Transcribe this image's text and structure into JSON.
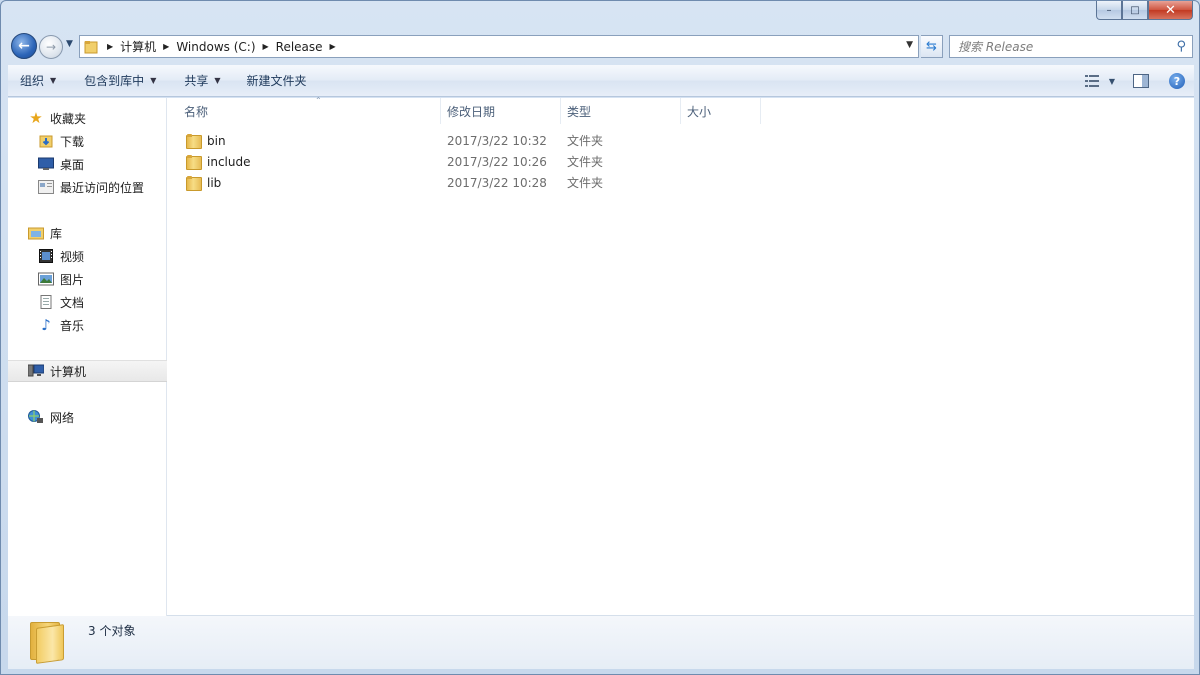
{
  "window": {
    "caption": {
      "minimize": "–",
      "maximize": "□",
      "close": "✕"
    }
  },
  "nav": {
    "breadcrumbs": [
      "计算机",
      "Windows (C:)",
      "Release"
    ],
    "search_placeholder": "搜索 Release"
  },
  "toolbar": {
    "organize": "组织",
    "include_in_library": "包含到库中",
    "share": "共享",
    "new_folder": "新建文件夹"
  },
  "sidebar": {
    "items": [
      {
        "label": "收藏夹",
        "icon": "star-icon"
      },
      {
        "label": "下载",
        "icon": "download-icon"
      },
      {
        "label": "桌面",
        "icon": "desktop-icon"
      },
      {
        "label": "最近访问的位置",
        "icon": "recent-places-icon"
      },
      {
        "label": "库",
        "icon": "library-icon"
      },
      {
        "label": "视频",
        "icon": "video-icon"
      },
      {
        "label": "图片",
        "icon": "pictures-icon"
      },
      {
        "label": "文档",
        "icon": "documents-icon"
      },
      {
        "label": "音乐",
        "icon": "music-icon"
      },
      {
        "label": "计算机",
        "icon": "computer-icon"
      },
      {
        "label": "网络",
        "icon": "network-icon"
      }
    ],
    "selected": "计算机"
  },
  "columns": {
    "name": "名称",
    "modified": "修改日期",
    "type": "类型",
    "size": "大小"
  },
  "files": [
    {
      "name": "bin",
      "modified": "2017/3/22 10:32",
      "type": "文件夹"
    },
    {
      "name": "include",
      "modified": "2017/3/22 10:26",
      "type": "文件夹"
    },
    {
      "name": "lib",
      "modified": "2017/3/22 10:28",
      "type": "文件夹"
    }
  ],
  "status": {
    "text": "3 个对象"
  },
  "colors": {
    "accent": "#2c65b8",
    "folder": "#f2cc63"
  }
}
